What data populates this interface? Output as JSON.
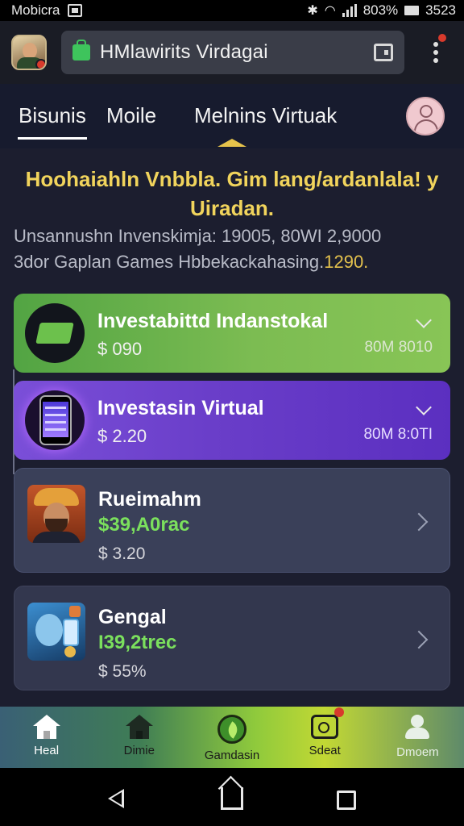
{
  "status_bar": {
    "carrier": "Mobicra",
    "battery_text": "803%",
    "time": "3523",
    "icons": [
      "notification-icon",
      "sync-icon",
      "wifi-icon",
      "signal-icon",
      "battery-icon"
    ]
  },
  "browser": {
    "url_text": "HMlawirits Virdagai",
    "icons": [
      "app-avatar-icon",
      "lock-icon",
      "tabs-icon",
      "overflow-menu-icon"
    ]
  },
  "top_nav": {
    "tabs": [
      {
        "label": "Bisunis"
      },
      {
        "label": "Moile"
      },
      {
        "label": "Melnins Virtuak"
      }
    ],
    "profile_icon": "profile-avatar-icon"
  },
  "headline": {
    "line1": "Hoohaiahln Vnbbla. Gim lang/ardanlala! y",
    "line2": "Uiradan."
  },
  "info": {
    "line1": "Unsannushn Invenskimja: 19005,  80WI 2,9000",
    "line2_prefix": "3dor Gaplan Games Hbbekackahasing.",
    "line2_highlight": "1290."
  },
  "cards": [
    {
      "title": "Investabittd Indanstokal",
      "price": "$ 090",
      "meta": "80M 8010",
      "icon": "green-slab-icon",
      "accent": "#7cbc52"
    },
    {
      "title": "Investasin Virtual",
      "price": "$ 2.20",
      "meta": "80M 8:0TI",
      "icon": "phone-icon",
      "accent": "#6a3ec9"
    },
    {
      "title": "Rueimahm",
      "gain": "$39,A0rac",
      "price": "$ 3.20",
      "icon": "man-portrait-icon"
    },
    {
      "title": "Gengal",
      "gain": "I39,2trec",
      "price": "$ 55%",
      "icon": "tech-portrait-icon"
    }
  ],
  "bottom_nav": [
    {
      "label": "Heal",
      "icon": "home-icon"
    },
    {
      "label": "Dimie",
      "icon": "house-icon"
    },
    {
      "label": "Gamdasin",
      "icon": "leaf-icon"
    },
    {
      "label": "Sdeat",
      "icon": "chat-icon"
    },
    {
      "label": "Dmoem",
      "icon": "user-icon"
    }
  ],
  "colors": {
    "headline": "#f1d45c",
    "gain": "#7be05d",
    "app_bg": "#1c1e2f"
  }
}
